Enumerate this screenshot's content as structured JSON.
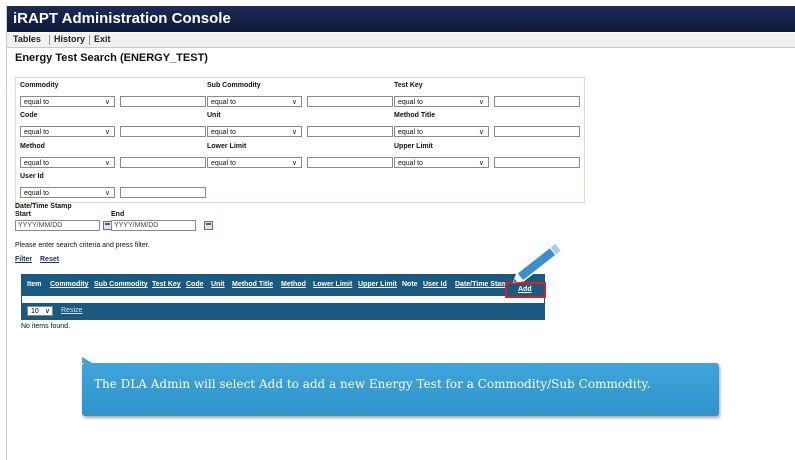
{
  "app": {
    "title": "iRAPT Administration Console"
  },
  "menu": [
    "Tables",
    "History",
    "Exit"
  ],
  "page": {
    "title": "Energy Test Search (ENERGY_TEST)"
  },
  "criteria": {
    "operator_value": "equal to",
    "fields": [
      {
        "label": "Commodity"
      },
      {
        "label": "Sub Commodity"
      },
      {
        "label": "Test Key"
      },
      {
        "label": "Code"
      },
      {
        "label": "Unit"
      },
      {
        "label": "Method Title"
      },
      {
        "label": "Method"
      },
      {
        "label": "Lower Limit"
      },
      {
        "label": "Upper Limit"
      },
      {
        "label": "User Id"
      }
    ]
  },
  "datetime": {
    "label": "Date/Time Stamp",
    "start_label": "Start",
    "end_label": "End",
    "placeholder": "YYYY/MM/DD"
  },
  "hint": "Please enter search criteria and press filter.",
  "actions": {
    "filter": "Filter",
    "reset": "Reset"
  },
  "grid": {
    "columns": [
      "Item",
      "Commodity",
      "Sub Commodity",
      "Test Key",
      "Code",
      "Unit",
      "Method Title",
      "Method",
      "Lower Limit",
      "Upper Limit",
      "Note",
      "User Id",
      "Date/Time Stamp"
    ],
    "add_label": "Add",
    "page_size": "10",
    "resize_label": "Resize",
    "empty_text": "No items found."
  },
  "callout": {
    "text": "The DLA Admin will select Add to add a new Energy Test for a Commodity/Sub Commodity."
  },
  "colors": {
    "title_bar": "#0d1a3d",
    "grid_header": "#1a5a80",
    "callout": "#3fa5d9",
    "highlight": "#d62020"
  },
  "icons": [
    "calendar-icon",
    "chevron-down-icon",
    "pencil-pointer-icon"
  ]
}
